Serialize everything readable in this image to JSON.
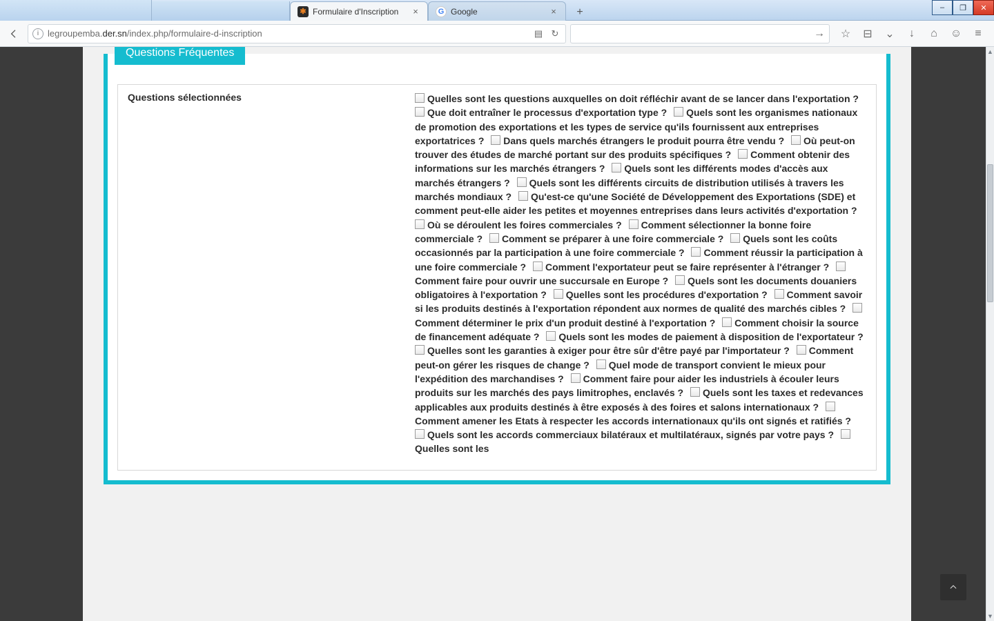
{
  "window": {
    "tabs": [
      {
        "label": "Formulaire d'Inscription",
        "active": true,
        "favicon": "ff"
      },
      {
        "label": "Google",
        "active": false,
        "favicon": "g"
      }
    ],
    "buttons": {
      "minimize": "–",
      "maximize": "❐",
      "close": "✕"
    }
  },
  "navbar": {
    "url_prefix": "legroupemba.",
    "url_host": "der.sn",
    "url_path": "/index.php/formulaire-d-inscription",
    "icons": {
      "info": "i",
      "reader": "▤",
      "reload": "↻",
      "go": "→",
      "star": "☆",
      "clipboard": "⊟",
      "pocket": "⌄",
      "download": "↓",
      "home": "⌂",
      "chat": "☺",
      "menu": "≡"
    }
  },
  "page": {
    "section_title": "Questions Fréquentes",
    "left_label": "Questions sélectionnées",
    "questions": [
      "Quelles sont les questions auxquelles on doit réfléchir avant de se lancer dans l'exportation ?",
      "Que doit entraîner le processus d'exportation type ?",
      "Quels sont les organismes nationaux de promotion des exportations et les types de service qu'ils fournissent aux entreprises exportatrices ?",
      "Dans quels marchés étrangers le produit pourra être vendu ?",
      "Où peut-on trouver des études de marché portant sur des produits spécifiques ?",
      "Comment obtenir des informations sur les marchés étrangers ?",
      "Quels sont les différents modes d'accès aux marchés étrangers ?",
      "Quels sont les différents circuits de distribution utilisés à travers les marchés mondiaux ?",
      "Qu'est-ce qu'une Société de Développement des Exportations (SDE) et comment peut-elle aider les petites et moyennes entreprises dans leurs activités d'exportation ?",
      "Où se déroulent les foires commerciales ?",
      "Comment sélectionner la bonne foire commerciale ?",
      "Comment se préparer à une foire commerciale ?",
      "Quels sont les coûts occasionnés par la participation à une foire commerciale ?",
      "Comment réussir la participation à une foire commerciale ?",
      "Comment l'exportateur peut se faire représenter à l'étranger ?",
      "Comment faire pour ouvrir une succursale en Europe ?",
      "Quels sont les documents douaniers obligatoires à l'exportation ?",
      "Quelles sont les procédures d'exportation ?",
      "Comment savoir si les produits destinés à l'exportation répondent aux normes de qualité des marchés cibles ?",
      "Comment déterminer le prix d'un produit destiné à l'exportation ?",
      "Comment choisir la source de financement adéquate ?",
      "Quels sont les modes de paiement à disposition de l'exportateur ?",
      "Quelles sont les garanties à exiger pour être sûr d'être payé par l'importateur ?",
      "Comment peut-on gérer les risques de change ?",
      "Quel mode de transport convient le mieux pour l'expédition des marchandises ?",
      "Comment faire pour aider les industriels à écouler leurs produits sur les marchés des pays limitrophes, enclavés ?",
      "Quels sont les taxes et redevances applicables aux produits destinés à être exposés à des foires et salons internationaux ?",
      "Comment amener les Etats à respecter les accords internationaux qu'ils ont signés et ratifiés ?",
      "Quels sont les accords commerciaux bilatéraux et multilatéraux, signés par votre pays ?",
      "Quelles sont les"
    ]
  }
}
